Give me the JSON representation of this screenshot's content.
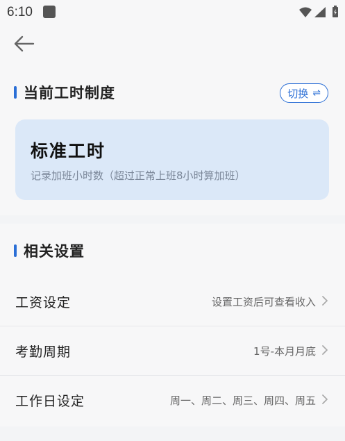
{
  "status_bar": {
    "time": "6:10",
    "icons": [
      "app-square-icon",
      "wifi-icon",
      "signal-icon",
      "battery-icon"
    ]
  },
  "top_bar": {
    "back_icon": "arrow-left-icon"
  },
  "work_hours": {
    "section_title": "当前工时制度",
    "switch_label": "切换",
    "switch_icon": "⇌",
    "mode_title": "标准工时",
    "mode_description": "记录加班小时数（超过正常上班8小时算加班）"
  },
  "settings": {
    "section_title": "相关设置",
    "rows": [
      {
        "label": "工资设定",
        "value": "设置工资后可查看收入"
      },
      {
        "label": "考勤周期",
        "value": "1号-本月月底"
      },
      {
        "label": "工作日设定",
        "value": "周一、周二、周三、周四、周五"
      }
    ]
  },
  "colors": {
    "accent": "#2b6fd6",
    "card_background": "#dbe8f8",
    "page_background": "#f3f4f6"
  }
}
